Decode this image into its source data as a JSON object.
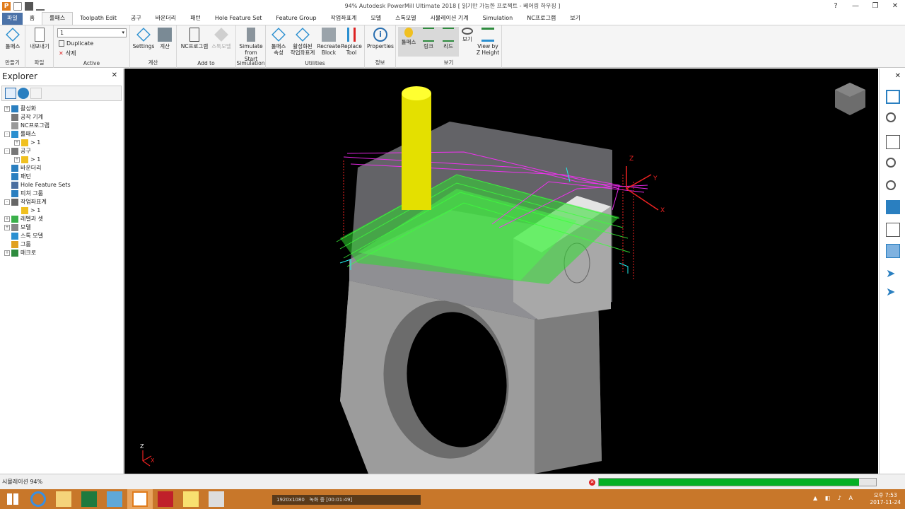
{
  "title": "94% Autodesk PowerMill Ultimate 2018  [ 읽기만 가능한 프로젝트 - 베어링 하우징 ]",
  "window_controls": {
    "help": "?",
    "minimize": "—",
    "restore": "❐",
    "close": "✕"
  },
  "tabs": [
    "파일",
    "홈",
    "툴패스",
    "Toolpath Edit",
    "공구",
    "바운더리",
    "패턴",
    "Hole Feature Set",
    "Feature Group",
    "작업좌표계",
    "모델",
    "스톡모델",
    "시뮬레이션 기계",
    "Simulation",
    "NC프로그램",
    "보기"
  ],
  "ribbon": {
    "create": {
      "label": "툴패스",
      "group": "만들기"
    },
    "file": {
      "label": "내보내기",
      "group": "파일"
    },
    "active": {
      "select_value": "1",
      "duplicate": "Duplicate",
      "delete": "삭제",
      "group": "Active"
    },
    "calc": {
      "settings": "Settings",
      "calc": "계산",
      "group": "계산"
    },
    "addto": {
      "nc": "NC프로그램",
      "stock": "스톡모델",
      "group": "Add to"
    },
    "sim": {
      "label1": "Simulate",
      "label2": "from Start",
      "group": "Simulation"
    },
    "util": {
      "props1": "툴패스",
      "props2": "속성",
      "active1": "활성화된",
      "active2": "작업좌표계",
      "recreate1": "Recreate",
      "recreate2": "Block",
      "replace1": "Replace",
      "replace2": "Tool",
      "group": "Utilities"
    },
    "info": {
      "label": "Properties",
      "group": "정보"
    },
    "view": {
      "toolpath": "툴패스",
      "link": "링크",
      "lead": "리드",
      "view": "보기",
      "zh1": "View by",
      "zh2": "Z Height",
      "group": "보기"
    }
  },
  "explorer": {
    "title": "Explorer",
    "items": [
      {
        "label": "활성화",
        "indent": 0,
        "exp": "+"
      },
      {
        "label": "공작 기계",
        "indent": 0,
        "exp": ""
      },
      {
        "label": "NC프로그램",
        "indent": 0,
        "exp": ""
      },
      {
        "label": "툴패스",
        "indent": 0,
        "exp": "-"
      },
      {
        "label": "> 1",
        "indent": 1,
        "exp": "+"
      },
      {
        "label": "공구",
        "indent": 0,
        "exp": "-"
      },
      {
        "label": "> 1",
        "indent": 1,
        "exp": "+"
      },
      {
        "label": "바운더리",
        "indent": 0,
        "exp": ""
      },
      {
        "label": "패턴",
        "indent": 0,
        "exp": ""
      },
      {
        "label": "Hole Feature Sets",
        "indent": 0,
        "exp": ""
      },
      {
        "label": "피쳐 그룹",
        "indent": 0,
        "exp": ""
      },
      {
        "label": "작업좌표계",
        "indent": 0,
        "exp": "-"
      },
      {
        "label": "> 1",
        "indent": 1,
        "exp": ""
      },
      {
        "label": "레벨과 셋",
        "indent": 0,
        "exp": "+"
      },
      {
        "label": "모델",
        "indent": 0,
        "exp": "+"
      },
      {
        "label": "스톡 모델",
        "indent": 0,
        "exp": ""
      },
      {
        "label": "그룹",
        "indent": 0,
        "exp": ""
      },
      {
        "label": "매크로",
        "indent": 0,
        "exp": "+"
      }
    ]
  },
  "status": {
    "text": "시뮬레이션 94%",
    "progress": 0.94
  },
  "recorder": {
    "resolution": "1920x1080",
    "status": "녹화 중 [00:01:49]"
  },
  "clock": {
    "time": "오후 7:53",
    "date": "2017-11-24"
  },
  "colors": {
    "file_tab": "#4b72a8",
    "progress": "#06b025",
    "taskbar": "#c8772a",
    "viewport": "#000000"
  }
}
